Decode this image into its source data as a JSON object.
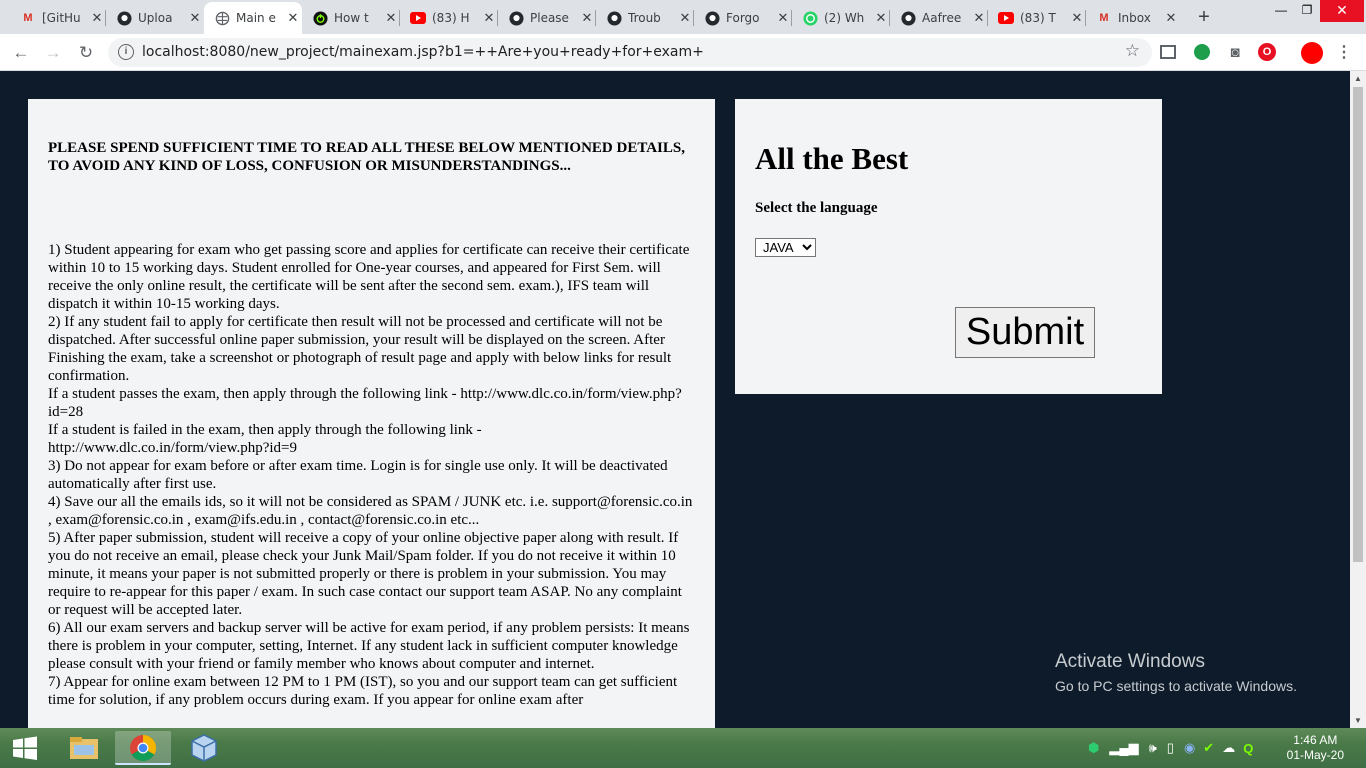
{
  "browser": {
    "tabs": [
      {
        "title": "[GitHu",
        "icon": "gmail-icon"
      },
      {
        "title": "Uploa",
        "icon": "github-icon"
      },
      {
        "title": "Main e",
        "icon": "globe-icon",
        "active": true
      },
      {
        "title": "How t",
        "icon": "power-icon"
      },
      {
        "title": "(83) H",
        "icon": "youtube-icon"
      },
      {
        "title": "Please",
        "icon": "github-icon"
      },
      {
        "title": "Troub",
        "icon": "github-icon"
      },
      {
        "title": "Forgo",
        "icon": "github-icon"
      },
      {
        "title": "(2) Wh",
        "icon": "whatsapp-icon"
      },
      {
        "title": "Aafree",
        "icon": "github-icon"
      },
      {
        "title": "(83) T",
        "icon": "youtube-icon"
      },
      {
        "title": "Inbox",
        "icon": "gmail-icon"
      }
    ],
    "url": "localhost:8080/new_project/mainexam.jsp?b1=++Are+you+ready+for+exam+"
  },
  "instructions": {
    "heading": "PLEASE SPEND SUFFICIENT TIME TO READ ALL THESE BELOW MENTIONED DETAILS, TO AVOID ANY KIND OF LOSS, CONFUSION OR MISUNDERSTANDINGS...",
    "lines": [
      "1) Student appearing for exam who get passing score and applies for certificate can receive their certificate within 10 to 15 working days. Student enrolled for One-year courses, and appeared for First Sem. will receive the only online result, the certificate will be sent after the second sem. exam.), IFS team will dispatch it within 10-15 working days.",
      "2) If any student fail to apply for certificate then result will not be processed and certificate will not be dispatched. After successful online paper submission, your result will be displayed on the screen. After Finishing the exam, take a screenshot or photograph of result page and apply with below links for result confirmation.",
      "If a student passes the exam, then apply through the following link - http://www.dlc.co.in/form/view.php?id=28",
      "If a student is failed in the exam, then apply through the following link - http://www.dlc.co.in/form/view.php?id=9",
      "3) Do not appear for exam before or after exam time. Login is for single use only. It will be deactivated automatically after first use.",
      "4) Save our all the emails ids, so it will not be considered as SPAM / JUNK etc. i.e. support@forensic.co.in , exam@forensic.co.in , exam@ifs.edu.in , contact@forensic.co.in etc...",
      "5) After paper submission, student will receive a copy of your online objective paper along with result. If you do not receive an email, please check your Junk Mail/Spam folder. If you do not receive it within 10 minute, it means your paper is not submitted properly or there is problem in your submission. You may require to re-appear for this paper / exam. In such case contact our support team ASAP. No any complaint or request will be accepted later.",
      "6) All our exam servers and backup server will be active for exam period, if any problem persists: It means there is problem in your computer, setting, Internet. If any student lack in sufficient computer knowledge please consult with your friend or family member who knows about computer and internet.",
      "7) Appear for online exam between 12 PM to 1 PM (IST), so you and our support team can get sufficient time for solution, if any problem occurs during exam. If you appear for online exam after"
    ]
  },
  "exam_card": {
    "title": "All the Best",
    "language_label": "Select the language",
    "language_selected": "JAVA",
    "submit_label": "Submit"
  },
  "watermark": {
    "title": "Activate Windows",
    "subtitle": "Go to PC settings to activate Windows."
  },
  "taskbar": {
    "time": "1:46 AM",
    "date": "01-May-20"
  },
  "colors": {
    "page_bg": "#0d1b2a",
    "panel_bg": "#f3f4f6",
    "close_red": "#e81123"
  }
}
